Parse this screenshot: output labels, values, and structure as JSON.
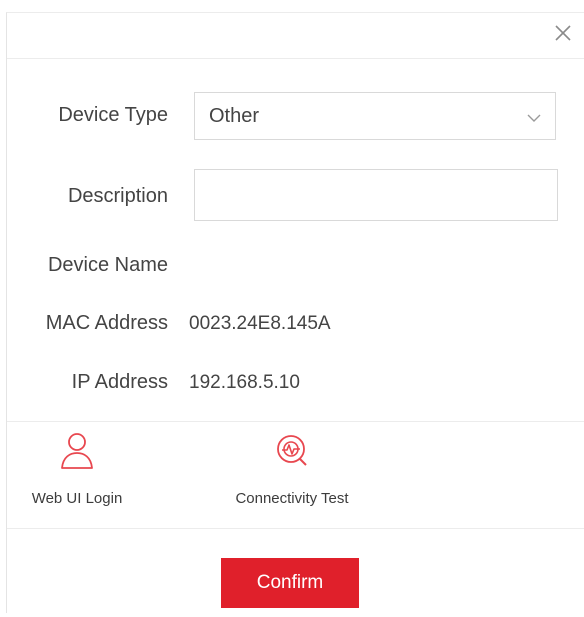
{
  "dialog": {
    "close_icon": "close-icon",
    "fields": {
      "device_type": {
        "label": "Device Type",
        "selected": "Other",
        "icon": "chevron-down-icon"
      },
      "description": {
        "label": "Description",
        "value": "",
        "placeholder": ""
      },
      "device_name": {
        "label": "Device Name",
        "value": ""
      },
      "mac_address": {
        "label": "MAC Address",
        "value": "0023.24E8.145A"
      },
      "ip_address": {
        "label": "IP Address",
        "value": "192.168.5.10"
      }
    },
    "actions": [
      {
        "label": "Web UI Login",
        "icon": "user-icon"
      },
      {
        "label": "Connectivity Test",
        "icon": "connectivity-test-icon"
      }
    ],
    "confirm_label": "Confirm"
  },
  "colors": {
    "accent": "#e0202b",
    "icon_red": "#e8474f",
    "border": "#d9d9d9",
    "text": "#444444"
  }
}
